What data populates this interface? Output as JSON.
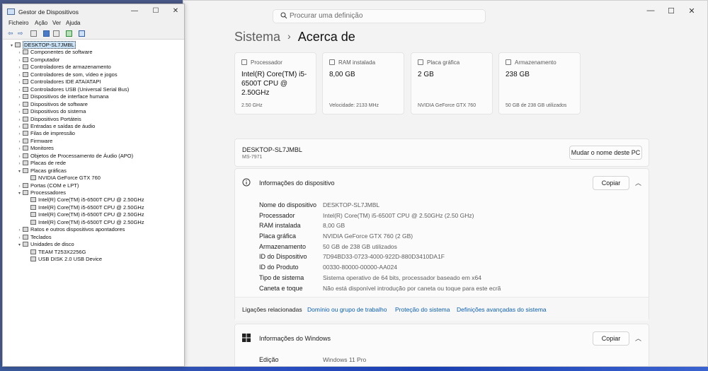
{
  "device_manager": {
    "title": "Gestor de Dispositivos",
    "menu": [
      "Ficheiro",
      "Ação",
      "Ver",
      "Ajuda"
    ],
    "tree": [
      {
        "label": "DESKTOP-SL7JMBL",
        "level": 0,
        "expander": "▾",
        "selected": true
      },
      {
        "label": "Componentes de software",
        "level": 1,
        "expander": "›"
      },
      {
        "label": "Computador",
        "level": 1,
        "expander": "›"
      },
      {
        "label": "Controladores de armazenamento",
        "level": 1,
        "expander": "›"
      },
      {
        "label": "Controladores de som, vídeo e jogos",
        "level": 1,
        "expander": "›"
      },
      {
        "label": "Controladores IDE ATA/ATAPI",
        "level": 1,
        "expander": "›"
      },
      {
        "label": "Controladores USB (Universal Serial Bus)",
        "level": 1,
        "expander": "›"
      },
      {
        "label": "Dispositivos de interface humana",
        "level": 1,
        "expander": "›"
      },
      {
        "label": "Dispositivos de software",
        "level": 1,
        "expander": "›"
      },
      {
        "label": "Dispositivos do sistema",
        "level": 1,
        "expander": "›"
      },
      {
        "label": "Dispositivos Portáteis",
        "level": 1,
        "expander": "›"
      },
      {
        "label": "Entradas e saídas de áudio",
        "level": 1,
        "expander": "›"
      },
      {
        "label": "Filas de impressão",
        "level": 1,
        "expander": "›"
      },
      {
        "label": "Firmware",
        "level": 1,
        "expander": "›"
      },
      {
        "label": "Monitores",
        "level": 1,
        "expander": "›"
      },
      {
        "label": "Objetos de Processamento de Áudio (APO)",
        "level": 1,
        "expander": "›"
      },
      {
        "label": "Placas de rede",
        "level": 1,
        "expander": "›"
      },
      {
        "label": "Placas gráficas",
        "level": 1,
        "expander": "▾"
      },
      {
        "label": "NVIDIA GeForce GTX 760",
        "level": 2,
        "expander": ""
      },
      {
        "label": "Portas (COM e LPT)",
        "level": 1,
        "expander": "›"
      },
      {
        "label": "Processadores",
        "level": 1,
        "expander": "▾"
      },
      {
        "label": "Intel(R) Core(TM) i5-6500T CPU @ 2.50GHz",
        "level": 2,
        "expander": ""
      },
      {
        "label": "Intel(R) Core(TM) i5-6500T CPU @ 2.50GHz",
        "level": 2,
        "expander": ""
      },
      {
        "label": "Intel(R) Core(TM) i5-6500T CPU @ 2.50GHz",
        "level": 2,
        "expander": ""
      },
      {
        "label": "Intel(R) Core(TM) i5-6500T CPU @ 2.50GHz",
        "level": 2,
        "expander": ""
      },
      {
        "label": "Ratos e outros dispositivos apontadores",
        "level": 1,
        "expander": "›"
      },
      {
        "label": "Teclados",
        "level": 1,
        "expander": "›"
      },
      {
        "label": "Unidades de disco",
        "level": 1,
        "expander": "▾"
      },
      {
        "label": "TEAM T253X2256G",
        "level": 2,
        "expander": ""
      },
      {
        "label": "USB DISK 2.0 USB Device",
        "level": 2,
        "expander": ""
      }
    ]
  },
  "settings": {
    "search_placeholder": "Procurar uma definição",
    "breadcrumb": {
      "parent": "Sistema",
      "separator": "›",
      "current": "Acerca de"
    },
    "spec_cards": [
      {
        "label": "Processador",
        "value": "Intel(R) Core(TM) i5-6500T CPU @ 2.50GHz",
        "sub": "2.50 GHz"
      },
      {
        "label": "RAM instalada",
        "value": "8,00 GB",
        "sub": "Velocidade: 2133 MHz"
      },
      {
        "label": "Placa gráfica",
        "value": "2 GB",
        "sub": "NVIDIA GeForce GTX 760"
      },
      {
        "label": "Armazenamento",
        "value": "238 GB",
        "sub": "50 GB de 238 GB utilizados"
      }
    ],
    "device_name": "DESKTOP-SL7JMBL",
    "device_model": "MS-7971",
    "rename_button": "Mudar o nome deste PC",
    "device_info": {
      "title": "Informações do dispositivo",
      "copy_button": "Copiar",
      "rows": [
        {
          "key": "Nome do dispositivo",
          "value": "DESKTOP-SL7JMBL"
        },
        {
          "key": "Processador",
          "value": "Intel(R) Core(TM) i5-6500T CPU @ 2.50GHz (2.50 GHz)"
        },
        {
          "key": "RAM instalada",
          "value": "8,00 GB"
        },
        {
          "key": "Placa gráfica",
          "value": "NVIDIA GeForce GTX 760 (2 GB)"
        },
        {
          "key": "Armazenamento",
          "value": "50 GB de 238 GB utilizados"
        },
        {
          "key": "ID do Dispositivo",
          "value": "7D94BD33-0723-4000-922D-880D3410DA1F"
        },
        {
          "key": "ID do Produto",
          "value": "00330-80000-00000-AA024"
        },
        {
          "key": "Tipo de sistema",
          "value": "Sistema operativo de 64 bits, processador baseado em x64"
        },
        {
          "key": "Caneta e toque",
          "value": "Não está disponível introdução por caneta ou toque para este ecrã"
        }
      ],
      "related_label": "Ligações relacionadas",
      "related_links": [
        "Domínio ou grupo de trabalho",
        "Proteção do sistema",
        "Definições avançadas do sistema"
      ]
    },
    "windows_info": {
      "title": "Informações do Windows",
      "copy_button": "Copiar",
      "rows": [
        {
          "key": "Edição",
          "value": "Windows 11 Pro"
        }
      ]
    }
  }
}
